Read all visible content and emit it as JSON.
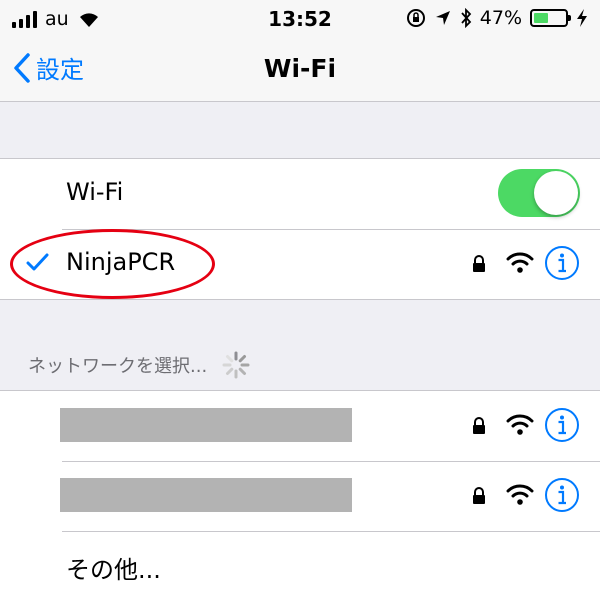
{
  "status_bar": {
    "carrier": "au",
    "time": "13:52",
    "battery_percent": "47%",
    "battery_level": 0.47,
    "icons": [
      "signal-icon",
      "wifi-icon",
      "orientation-lock-icon",
      "location-icon",
      "bluetooth-icon",
      "battery-icon",
      "charging-icon"
    ]
  },
  "nav": {
    "back_label": "設定",
    "title": "Wi-Fi"
  },
  "wifi_toggle": {
    "label": "Wi-Fi",
    "on": true
  },
  "connected_network": {
    "name": "NinjaPCR",
    "secured": true
  },
  "network_list": {
    "header": "ネットワークを選択...",
    "networks": [
      {
        "name": "",
        "redacted": true,
        "secured": true
      },
      {
        "name": "",
        "redacted": true,
        "secured": true
      }
    ],
    "other_label": "その他..."
  },
  "colors": {
    "accent": "#007aff",
    "toggle_on": "#4cd964",
    "annotation": "#e50012",
    "background": "#efeff4"
  }
}
